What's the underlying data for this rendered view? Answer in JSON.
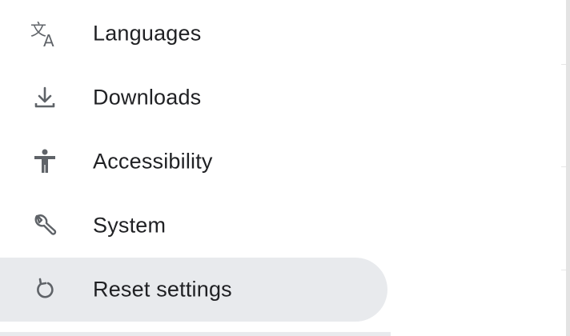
{
  "sidebar": {
    "items": [
      {
        "label": "Languages",
        "icon": "translate-icon",
        "selected": false
      },
      {
        "label": "Downloads",
        "icon": "download-icon",
        "selected": false
      },
      {
        "label": "Accessibility",
        "icon": "accessibility-icon",
        "selected": false
      },
      {
        "label": "System",
        "icon": "wrench-icon",
        "selected": false
      },
      {
        "label": "Reset settings",
        "icon": "reset-icon",
        "selected": true
      }
    ]
  },
  "colors": {
    "selected_bg": "#e8eaed",
    "text": "#202124",
    "icon": "#5f6368"
  }
}
